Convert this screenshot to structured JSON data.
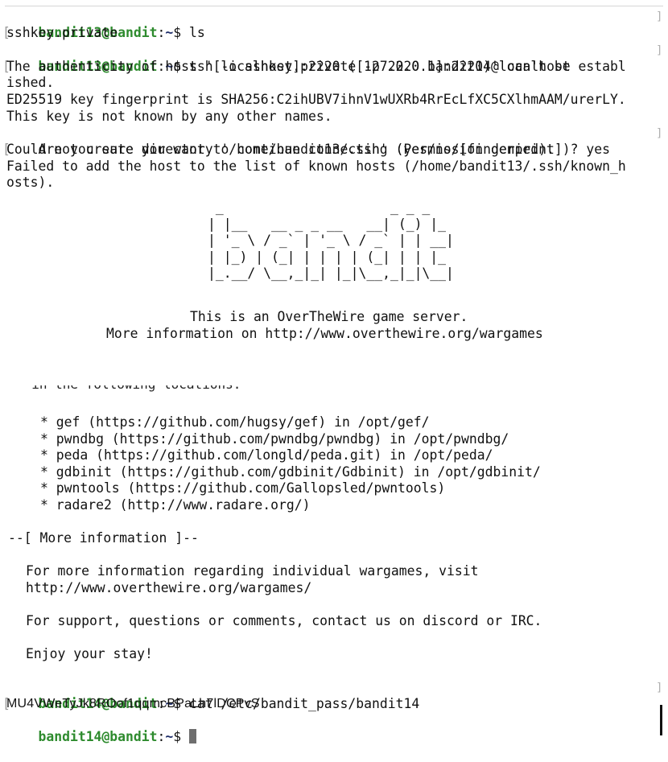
{
  "prompt1": {
    "user": "bandit13@bandit",
    "sep": ":",
    "path": "~",
    "sym": "$",
    "cmd": " ls"
  },
  "out_ls": "sshkey.private",
  "prompt2": {
    "user": "bandit13@bandit",
    "sep": ":",
    "path": "~",
    "sym": "$",
    "cmd": " ssh -i sshkey.private -p 2220 bandit14@localhost"
  },
  "ssh_output": [
    "The authenticity of host '[localhost]:2220 ([127.0.0.1]:2220)' can't be establ",
    "ished.",
    "ED25519 key fingerprint is SHA256:C2ihUBV7ihnV1wUXRb4RrEcLfXC5CXlhmAAM/urerLY.",
    "This key is not known by any other names.",
    "Are you sure you want to continue connecting (yes/no/[fingerprint])? yes",
    "Could not create directory '/home/bandit13/.ssh' (Permission denied).",
    "Failed to add the host to the list of known hosts (/home/bandit13/.ssh/known_h",
    "osts)."
  ],
  "banner_ascii": " _                     _ _ _\n| |__   __ _ _ __   __| (_) |_\n| '_ \\ / _` | '_ \\ / _` | | __|\n| |_) | (_| | | | | (_| | | |_\n|_.__/ \\__,_|_| |_|\\__,_|_|\\__|",
  "server_line1": "This is an OverTheWire game server.",
  "server_line2": "More information on http://www.overthewire.org/wargames",
  "partial_line": "  in the following locations:",
  "tools": [
    "* gef (https://github.com/hugsy/gef) in /opt/gef/",
    "* pwndbg (https://github.com/pwndbg/pwndbg) in /opt/pwndbg/",
    "* peda (https://github.com/longld/peda.git) in /opt/peda/",
    "* gdbinit (https://github.com/gdbinit/Gdbinit) in /opt/gdbinit/",
    "* pwntools (https://github.com/Gallopsled/pwntools)",
    "* radare2 (http://www.radare.org/)"
  ],
  "more_info_header": "--[ More information ]--",
  "more_info_1a": "For more information regarding individual wargames, visit",
  "more_info_1b": "http://www.overthewire.org/wargames/",
  "support_line": "For support, questions or comments, contact us on discord or IRC.",
  "enjoy_line": "Enjoy your stay!",
  "prompt3": {
    "user": "bandit14@bandit",
    "sep": ":",
    "path": "~",
    "sym": "$",
    "cmd": " cat /etc/bandit_pass/bandit14"
  },
  "password": "MU4VWeTyJk8ROof1qqmcBPaLh7lDCPvS",
  "prompt4": {
    "user": "bandit14@bandit",
    "sep": ":",
    "path": "~",
    "sym": "$",
    "cmd": " "
  }
}
